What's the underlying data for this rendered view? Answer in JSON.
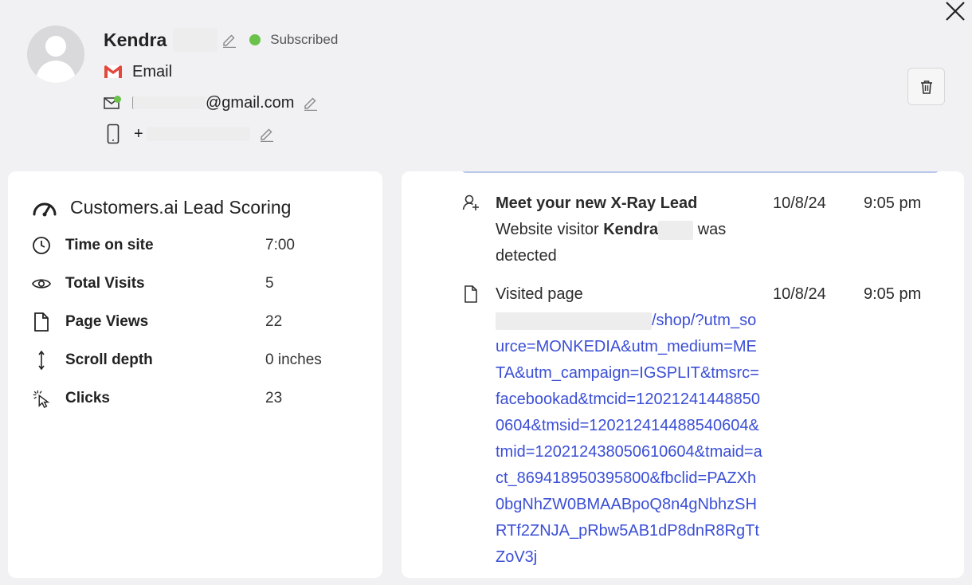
{
  "contact": {
    "first_name": "Kendra",
    "status": "Subscribed",
    "channel": "Email",
    "email_suffix": "@gmail.com",
    "phone_prefix": "+"
  },
  "scoring": {
    "title": "Customers.ai Lead Scoring",
    "metrics": [
      {
        "icon": "clock-icon",
        "label": "Time on site",
        "value": "7:00"
      },
      {
        "icon": "eye-icon",
        "label": "Total Visits",
        "value": "5"
      },
      {
        "icon": "page-icon",
        "label": "Page Views",
        "value": "22"
      },
      {
        "icon": "scroll-icon",
        "label": "Scroll depth",
        "value": "0 inches"
      },
      {
        "icon": "click-icon",
        "label": "Clicks",
        "value": "23"
      }
    ]
  },
  "activity": [
    {
      "icon": "user-add-icon",
      "title": "Meet your new X-Ray Lead",
      "text_prefix": "Website visitor ",
      "text_name": "Kendra",
      "text_suffix": " was detected",
      "date": "10/8/24",
      "time": "9:05 pm"
    },
    {
      "icon": "page-icon",
      "title": "Visited page",
      "url": "/shop/?utm_source=MONKEDIA&utm_medium=META&utm_campaign=IGSPLIT&tmsrc=facebookad&tmcid=120212414488500604&tmsid=120212414488540604&tmid=120212438050610604&tmaid=act_869418950395800&fbclid=PAZXh0bgNhZW0BMAABpoQ8n4gNbhzSHRTf2ZNJA_pRbw5AB1dP8dnR8RgTtZoV3j",
      "date": "10/8/24",
      "time": "9:05 pm"
    }
  ],
  "colors": {
    "subscribed_dot": "#6bc24a",
    "link": "#3b4fd6",
    "gmail_red": "#e4483d"
  }
}
